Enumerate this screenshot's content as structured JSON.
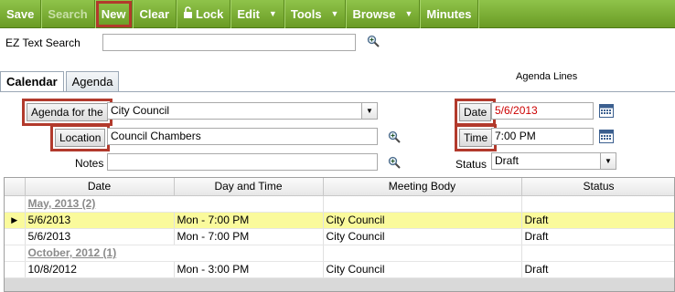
{
  "toolbar": {
    "save": "Save",
    "search": "Search",
    "new": "New",
    "clear": "Clear",
    "lock": "Lock",
    "edit": "Edit",
    "tools": "Tools",
    "browse": "Browse",
    "minutes": "Minutes"
  },
  "search": {
    "label": "EZ Text Search",
    "value": ""
  },
  "tabs": [
    "Calendar",
    "Agenda"
  ],
  "agenda_lines_label": "Agenda Lines",
  "form": {
    "agenda_for_label": "Agenda for the",
    "agenda_for_value": "City Council",
    "location_label": "Location",
    "location_value": "Council Chambers",
    "notes_label": "Notes",
    "notes_value": "",
    "date_label": "Date",
    "date_value": "5/6/2013",
    "time_label": "Time",
    "time_value": "7:00 PM",
    "status_label": "Status",
    "status_value": "Draft"
  },
  "grid": {
    "columns": [
      "Date",
      "Day and Time",
      "Meeting Body",
      "Status"
    ],
    "groups": [
      {
        "label": "May, 2013 (2)",
        "rows": [
          {
            "date": "5/6/2013",
            "day_time": "Mon - 7:00 PM",
            "body": "City Council",
            "status": "Draft",
            "current": true
          },
          {
            "date": "5/6/2013",
            "day_time": "Mon - 7:00 PM",
            "body": "City Council",
            "status": "Draft",
            "current": false
          }
        ]
      },
      {
        "label": "October, 2012 (1)",
        "rows": [
          {
            "date": "10/8/2012",
            "day_time": "Mon - 3:00 PM",
            "body": "City Council",
            "status": "Draft",
            "current": false
          }
        ]
      }
    ]
  },
  "colors": {
    "toolbar_green": "#7cb033",
    "highlight_red": "#b23a2c",
    "current_row": "#fafa9c",
    "date_text": "#cc0000"
  }
}
